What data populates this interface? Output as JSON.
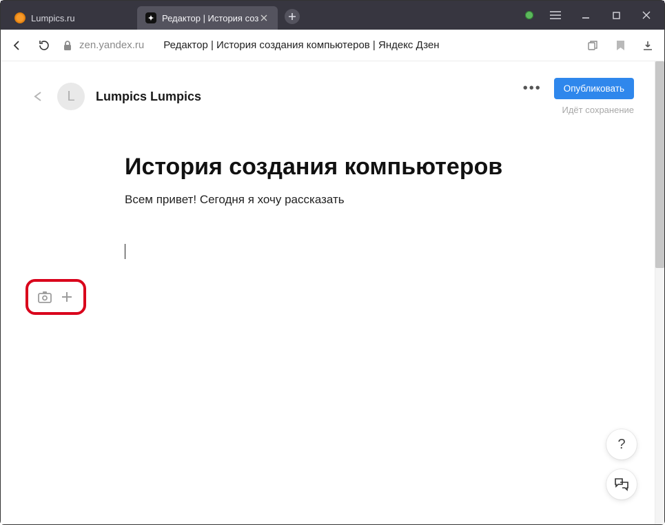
{
  "browser": {
    "tabs": [
      {
        "title": "Lumpics.ru",
        "active": false
      },
      {
        "title": "Редактор | История соз",
        "active": true
      }
    ],
    "domain": "zen.yandex.ru",
    "page_title": "Редактор | История создания компьютеров | Яндекс Дзен"
  },
  "editor": {
    "avatar_letter": "L",
    "channel_name": "Lumpics Lumpics",
    "publish_label": "Опубликовать",
    "save_status": "Идёт сохранение"
  },
  "article": {
    "title": "История создания компьютеров",
    "body": "Всем привет! Сегодня я хочу рассказать"
  },
  "help_label": "?"
}
